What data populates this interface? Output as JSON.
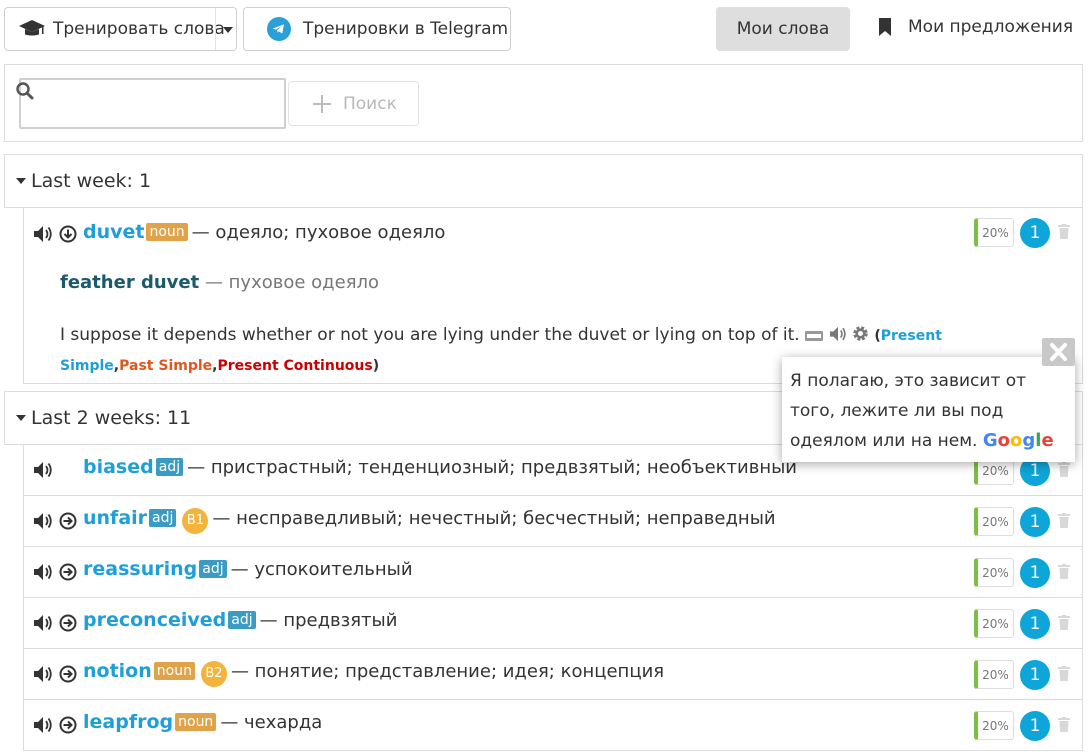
{
  "toolbar": {
    "train_label": "Тренировать слова",
    "telegram_label": "Тренировки в Telegram",
    "my_words_label": "Мои слова",
    "my_sentences_label": "Мои предложения"
  },
  "search": {
    "value": "",
    "placeholder": "",
    "button_label": "Поиск"
  },
  "colors": {
    "accent": "#1f9fd8",
    "noun_tag": "#e0a34a",
    "adj_tag": "#3a9cc2",
    "level_badge": "#f2b43a",
    "progress": "#7ac143"
  },
  "groups": [
    {
      "title": "Last week: 1",
      "words": [
        {
          "word": "duvet",
          "pos": "noun",
          "translation": "— одеяло; пуховое одеяло",
          "progress": "20%",
          "count": "1",
          "phrase": {
            "text": "feather duvet",
            "translation": "— пуховое одеяло"
          },
          "example": {
            "text": "I suppose it depends whether or not you are lying under the duvet or lying on top of it.",
            "open": "(",
            "t1": "Present Simple",
            "comma1": ",",
            "t2": "Past Simple",
            "comma2": ",",
            "t3": "Present Continuous",
            "close": ")"
          }
        }
      ]
    },
    {
      "title": "Last 2 weeks: 11",
      "words": [
        {
          "word": "biased",
          "pos": "adj",
          "level": "",
          "translation": "— пристрастный; тенденциозный; предвзятый; необъективный",
          "progress": "20%",
          "count": "1"
        },
        {
          "word": "unfair",
          "pos": "adj",
          "level": "B1",
          "translation": "— несправедливый; нечестный; бесчестный; неправедный",
          "progress": "20%",
          "count": "1"
        },
        {
          "word": "reassuring",
          "pos": "adj",
          "level": "",
          "translation": "— успокоительный",
          "progress": "20%",
          "count": "1"
        },
        {
          "word": "preconceived",
          "pos": "adj",
          "level": "",
          "translation": "— предвзятый",
          "progress": "20%",
          "count": "1"
        },
        {
          "word": "notion",
          "pos": "noun",
          "level": "B2",
          "translation": "— понятие; представление; идея; концепция",
          "progress": "20%",
          "count": "1"
        },
        {
          "word": "leapfrog",
          "pos": "noun",
          "level": "",
          "translation": "— чехарда",
          "progress": "20%",
          "count": "1"
        }
      ]
    }
  ],
  "tooltip": {
    "text": "Я полагаю, это зависит от того, лежите ли вы под одеялом или на нем.",
    "brand": [
      "G",
      "o",
      "o",
      "g",
      "l",
      "e"
    ]
  }
}
